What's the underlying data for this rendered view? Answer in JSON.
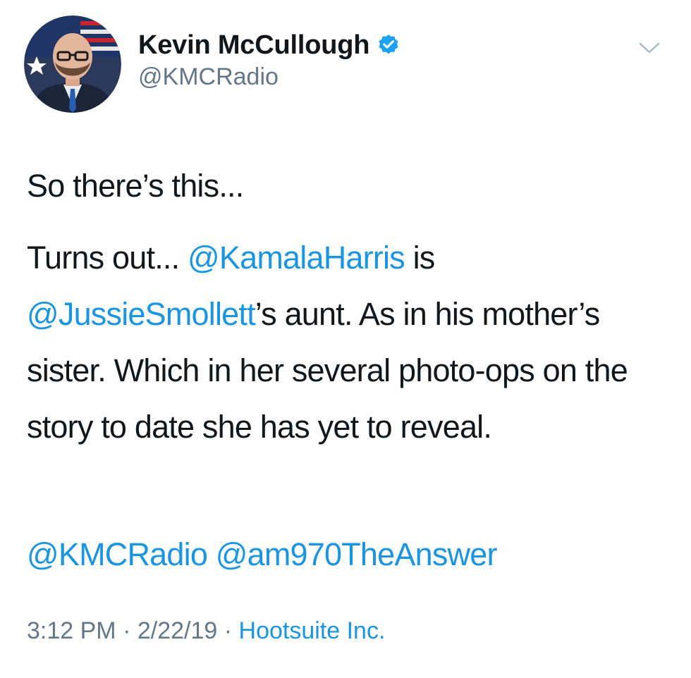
{
  "author": {
    "display_name": "Kevin McCullough",
    "handle": "@KMCRadio",
    "verified": true
  },
  "tweet": {
    "line1": "So there’s this...",
    "p2_seg1": "Turns out... ",
    "mention_kamala": "@KamalaHarris",
    "p2_seg2": " is ",
    "mention_jussie": "@JussieSmollett",
    "p2_seg3": "’s aunt. As in his mother’s sister. Which in her several photo-ops on the story to date she has yet to reveal.",
    "mention_kmc": "@KMCRadio",
    "mention_sep": " ",
    "mention_am970": "@am970TheAnswer"
  },
  "meta": {
    "time": "3:12 PM",
    "sep1": " · ",
    "date": "2/22/19",
    "sep2": " · ",
    "source": "Hootsuite Inc."
  },
  "icons": {
    "verified": "verified-badge-icon",
    "menu": "chevron-down-icon"
  },
  "colors": {
    "link": "#1b95e0",
    "secondary_text": "#657786",
    "primary_text": "#14171a"
  }
}
